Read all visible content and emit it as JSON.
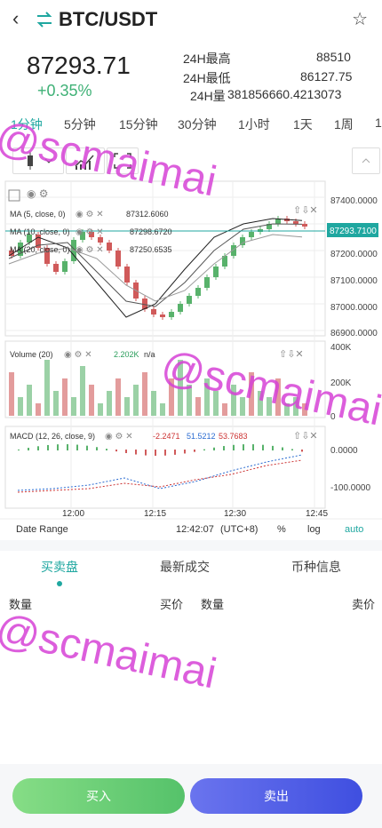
{
  "header": {
    "back_icon": "chevron-left-icon",
    "swap_icon": "swap-icon",
    "pair": "BTC/USDT",
    "favorite_icon": "star-icon"
  },
  "ticker": {
    "price": "87293.71",
    "change": "+0.35%",
    "high_label": "24H最高",
    "high_value": "88510",
    "low_label": "24H最低",
    "low_value": "86127.75",
    "vol_label": "24H量",
    "vol_value": "381856660.4213073"
  },
  "timeframes": [
    "1分钟",
    "5分钟",
    "15分钟",
    "30分钟",
    "1小时",
    "1天",
    "1周",
    "1"
  ],
  "active_timeframe": "1分钟",
  "chart_toolbar": {
    "candle_icon": "candlestick-icon",
    "indicator_icon": "indicator-icon",
    "fullscreen_icon": "fullscreen-icon",
    "collapse_icon": "chevron-up-icon"
  },
  "chart": {
    "ma_labels": [
      "MA (5, close, 0)",
      "MA (10, close, 0)",
      "MA (20, close, 0)"
    ],
    "ma_values": [
      "87312.6060",
      "87298.6720",
      "87250.6535"
    ],
    "current_price_tag": "87293.7100",
    "price_ticks": [
      "87400.0000",
      "87300.0000",
      "87200.0000",
      "87100.0000",
      "87000.0000",
      "86900.0000"
    ],
    "volume_label": "Volume (20)",
    "volume_value": "2.202K",
    "volume_na": "n/a",
    "volume_ticks": [
      "400K",
      "200K",
      "0"
    ],
    "macd_label": "MACD (12, 26, close, 9)",
    "macd_values": [
      "-2.2471",
      "51.5212",
      "53.7683"
    ],
    "macd_ticks": [
      "0.0000",
      "-100.0000"
    ],
    "time_ticks": [
      "12:00",
      "12:15",
      "12:30",
      "12:45"
    ],
    "date_range": "Date Range",
    "clock": "12:42:07",
    "tz": "(UTC+8)",
    "pct": "%",
    "log": "log",
    "auto": "auto"
  },
  "chart_data": {
    "type": "line",
    "x": [
      "11:55",
      "12:00",
      "12:05",
      "12:10",
      "12:15",
      "12:20",
      "12:25",
      "12:30",
      "12:35",
      "12:40",
      "12:42"
    ],
    "series": [
      {
        "name": "MA (5, close, 0)",
        "values": [
          87180,
          87250,
          87210,
          87080,
          86950,
          87000,
          87130,
          87250,
          87300,
          87320,
          87312.6
        ]
      },
      {
        "name": "MA (10, close, 0)",
        "values": [
          87170,
          87220,
          87230,
          87120,
          87010,
          86990,
          87080,
          87200,
          87280,
          87300,
          87298.7
        ]
      },
      {
        "name": "MA (20, close, 0)",
        "values": [
          87150,
          87190,
          87210,
          87170,
          87070,
          87010,
          87050,
          87150,
          87230,
          87260,
          87250.7
        ]
      }
    ],
    "ylim": [
      86900,
      87400
    ],
    "volume_ylim": [
      0,
      400000
    ],
    "macd_ylim": [
      -100,
      0
    ]
  },
  "tabs": [
    "买卖盘",
    "最新成交",
    "币种信息"
  ],
  "active_tab": "买卖盘",
  "orderbook": {
    "qty": "数量",
    "buy": "买价",
    "qty2": "数量",
    "sell": "卖价"
  },
  "footer": {
    "buy": "买入",
    "sell": "卖出"
  },
  "watermark": "@scmaimai",
  "colors": {
    "up": "#58b26b",
    "down": "#d05a5a",
    "accent": "#1fa7a0",
    "buy": "#55c26a",
    "sell": "#3f4fe0"
  }
}
